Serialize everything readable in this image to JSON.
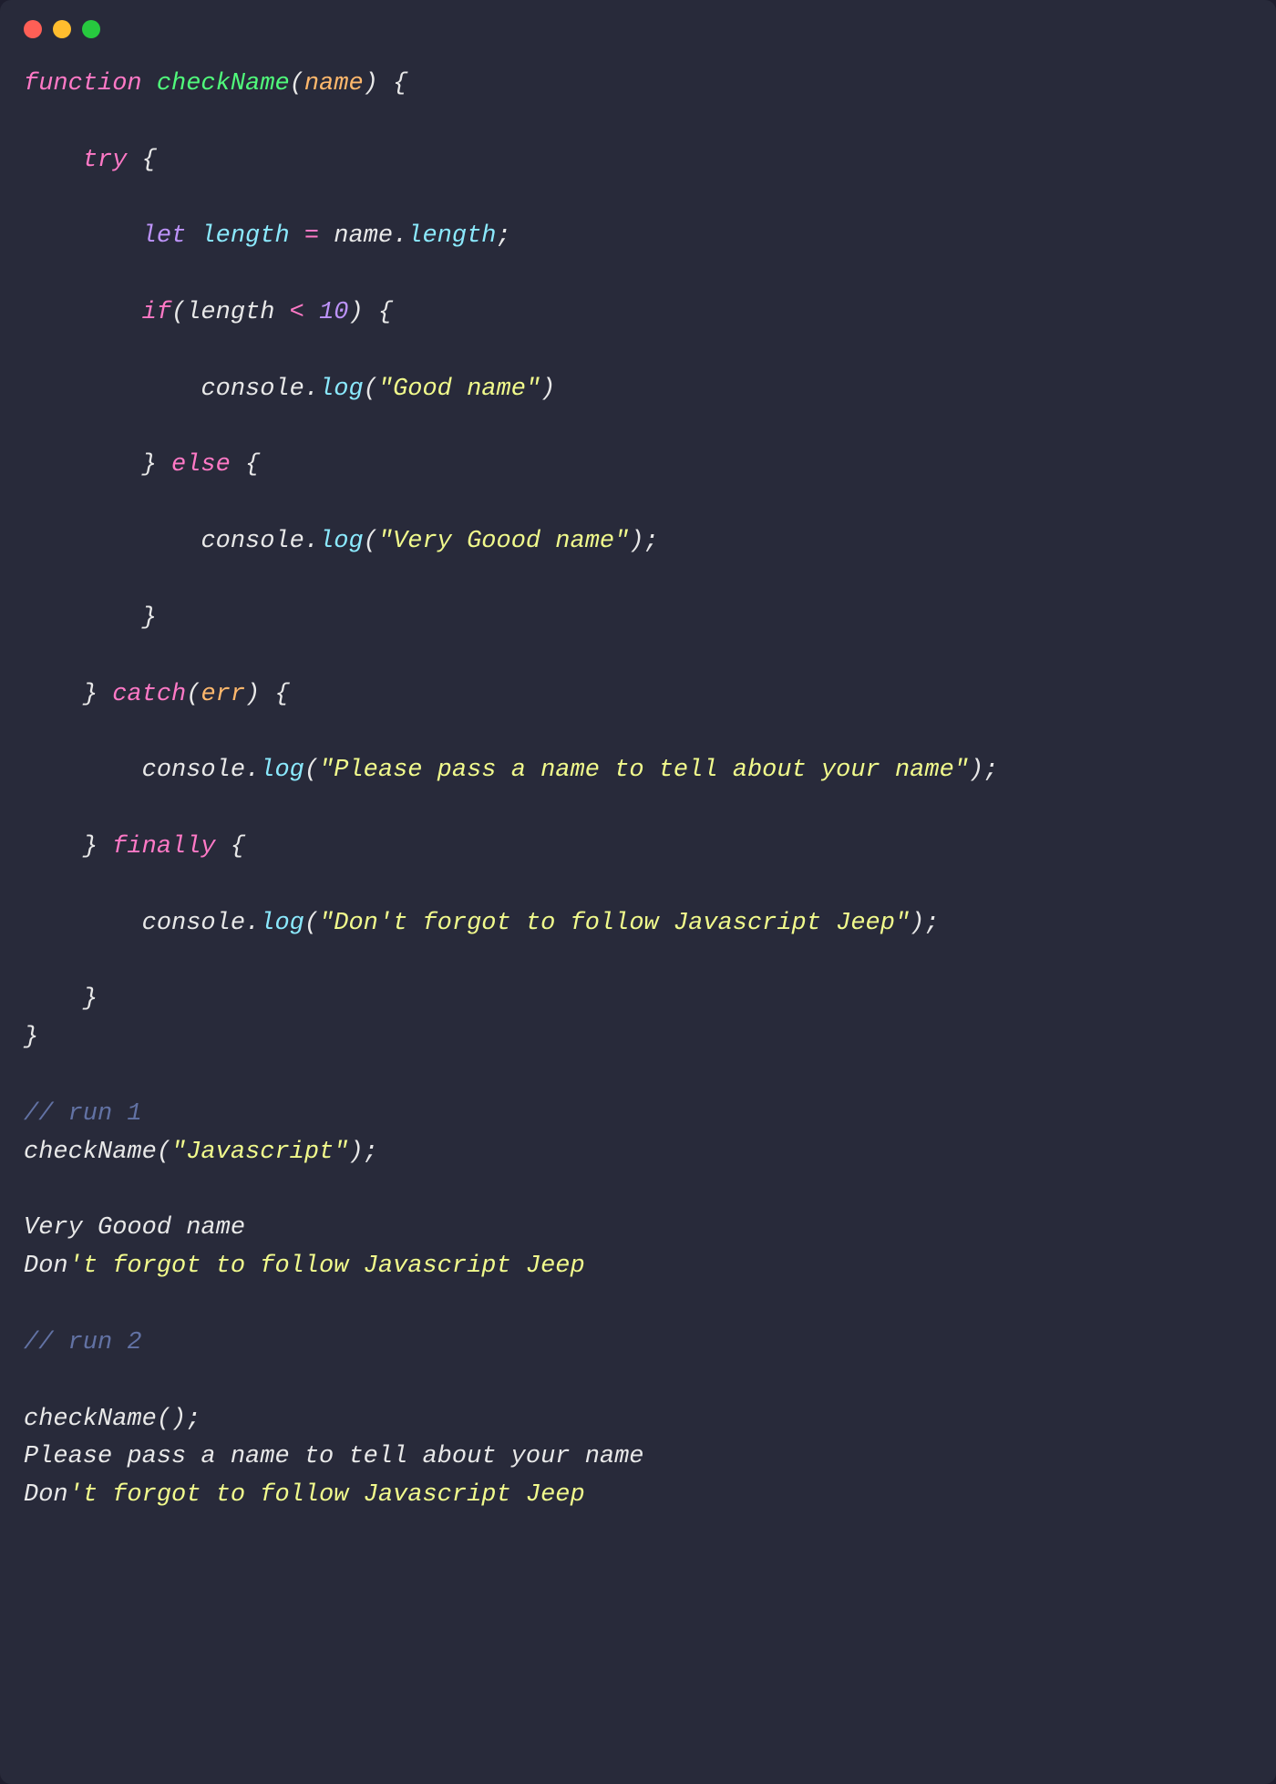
{
  "code": {
    "l1": {
      "fn": "function",
      "name": "checkName",
      "p1": "(",
      "arg": "name",
      "p2": ")",
      "brace": " {"
    },
    "l2": {
      "try": "try",
      "brace": " {"
    },
    "l3": {
      "let": "let",
      "var": "length",
      "eq": " = ",
      "obj": "name",
      "dot": ".",
      "prop": "length",
      "semi": ";"
    },
    "l4": {
      "if": "if",
      "p1": "(",
      "var": "length",
      "op": " < ",
      "num": "10",
      "p2": ")",
      "brace": " {"
    },
    "l5": {
      "obj": "console",
      "dot": ".",
      "fn": "log",
      "p1": "(",
      "str": "\"Good name\"",
      "p2": ")"
    },
    "l6": {
      "brace1": "}",
      "else": " else ",
      "brace2": "{"
    },
    "l7": {
      "obj": "console",
      "dot": ".",
      "fn": "log",
      "p1": "(",
      "str": "\"Very Goood name\"",
      "p2": ")",
      "semi": ";"
    },
    "l8": {
      "brace": "}"
    },
    "l9": {
      "brace1": "}",
      "catch": " catch",
      "p1": "(",
      "arg": "err",
      "p2": ")",
      "brace2": " {"
    },
    "l10": {
      "obj": "console",
      "dot": ".",
      "fn": "log",
      "p1": "(",
      "str": "\"Please pass a name to tell about your name\"",
      "p2": ")",
      "semi": ";"
    },
    "l11": {
      "brace1": "}",
      "finally": " finally ",
      "brace2": "{"
    },
    "l12": {
      "obj": "console",
      "dot": ".",
      "fn": "log",
      "p1": "(",
      "str": "\"Don't forgot to follow Javascript Jeep\"",
      "p2": ")",
      "semi": ";"
    },
    "l13": {
      "brace": "}"
    },
    "l14": {
      "brace": "}"
    },
    "c1": "// run 1",
    "call1": {
      "fn": "checkName",
      "p1": "(",
      "str": "\"Javascript\"",
      "p2": ")",
      "semi": ";"
    },
    "out1a_pre": "Very Goood name",
    "out1b_pre": "Don",
    "out1b_ap": "'",
    "out1b_post": "t forgot to follow Javascript Jeep",
    "c2": "// run 2",
    "call2": {
      "fn": "checkName",
      "p1": "(",
      "p2": ")",
      "semi": ";"
    },
    "out2a": "Please pass a name to tell about your name",
    "out2b_pre": "Don",
    "out2b_ap": "'",
    "out2b_post": "t forgot to follow Javascript Jeep"
  }
}
